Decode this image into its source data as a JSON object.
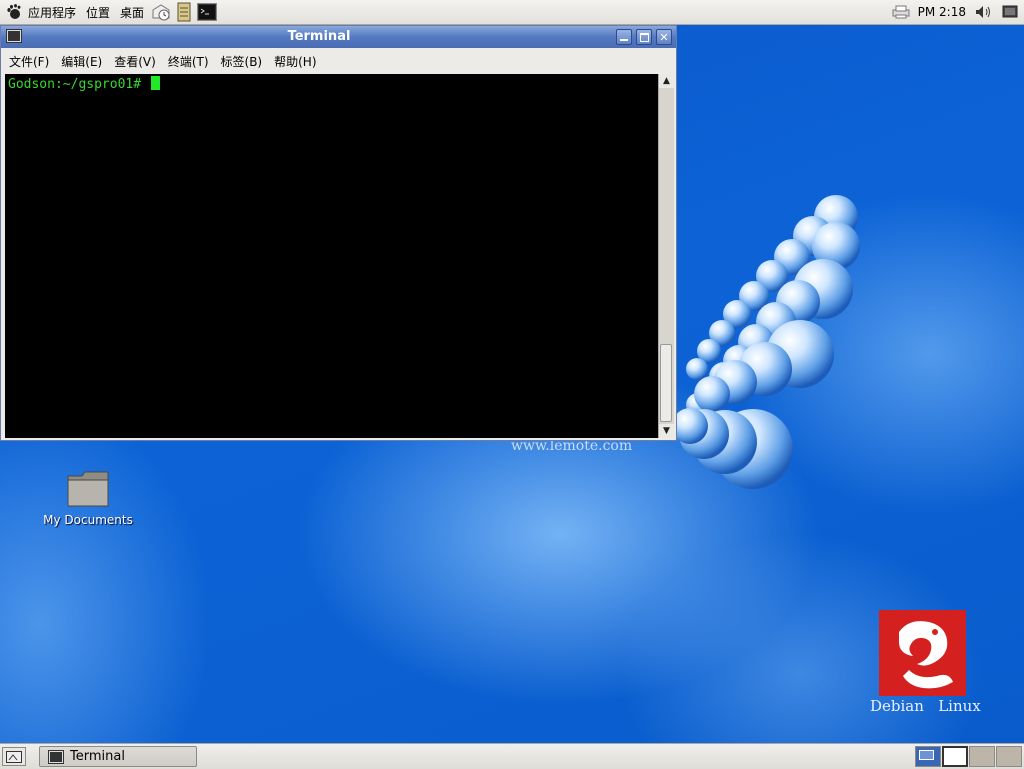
{
  "top_panel": {
    "menus": [
      "应用程序",
      "位置",
      "桌面"
    ],
    "launchers": [
      "mail-clock-icon",
      "notes-icon",
      "terminal-launcher-icon"
    ],
    "clock": "PM 2:18"
  },
  "terminal_window": {
    "title": "Terminal",
    "menu": [
      "文件(F)",
      "编辑(E)",
      "查看(V)",
      "终端(T)",
      "标签(B)",
      "帮助(H)"
    ],
    "prompt": "Godson:~/gspro01# "
  },
  "desktop": {
    "watermark": "www.lemote.com",
    "icons": [
      {
        "label": "My Documents",
        "icon": "folder-icon"
      }
    ],
    "brand_text": "Debian   Linux"
  },
  "bottom_panel": {
    "tasks": [
      {
        "label": "Terminal",
        "icon": "terminal-icon"
      }
    ],
    "workspaces": 4,
    "active_workspace": 1
  },
  "colors": {
    "desktop_blue": "#0b5fcf",
    "titlebar": "#5579c0",
    "terminal_bg": "#000000",
    "prompt_text": "#39d62f",
    "cursor": "#22e82a",
    "logo_red": "#d4211f"
  }
}
